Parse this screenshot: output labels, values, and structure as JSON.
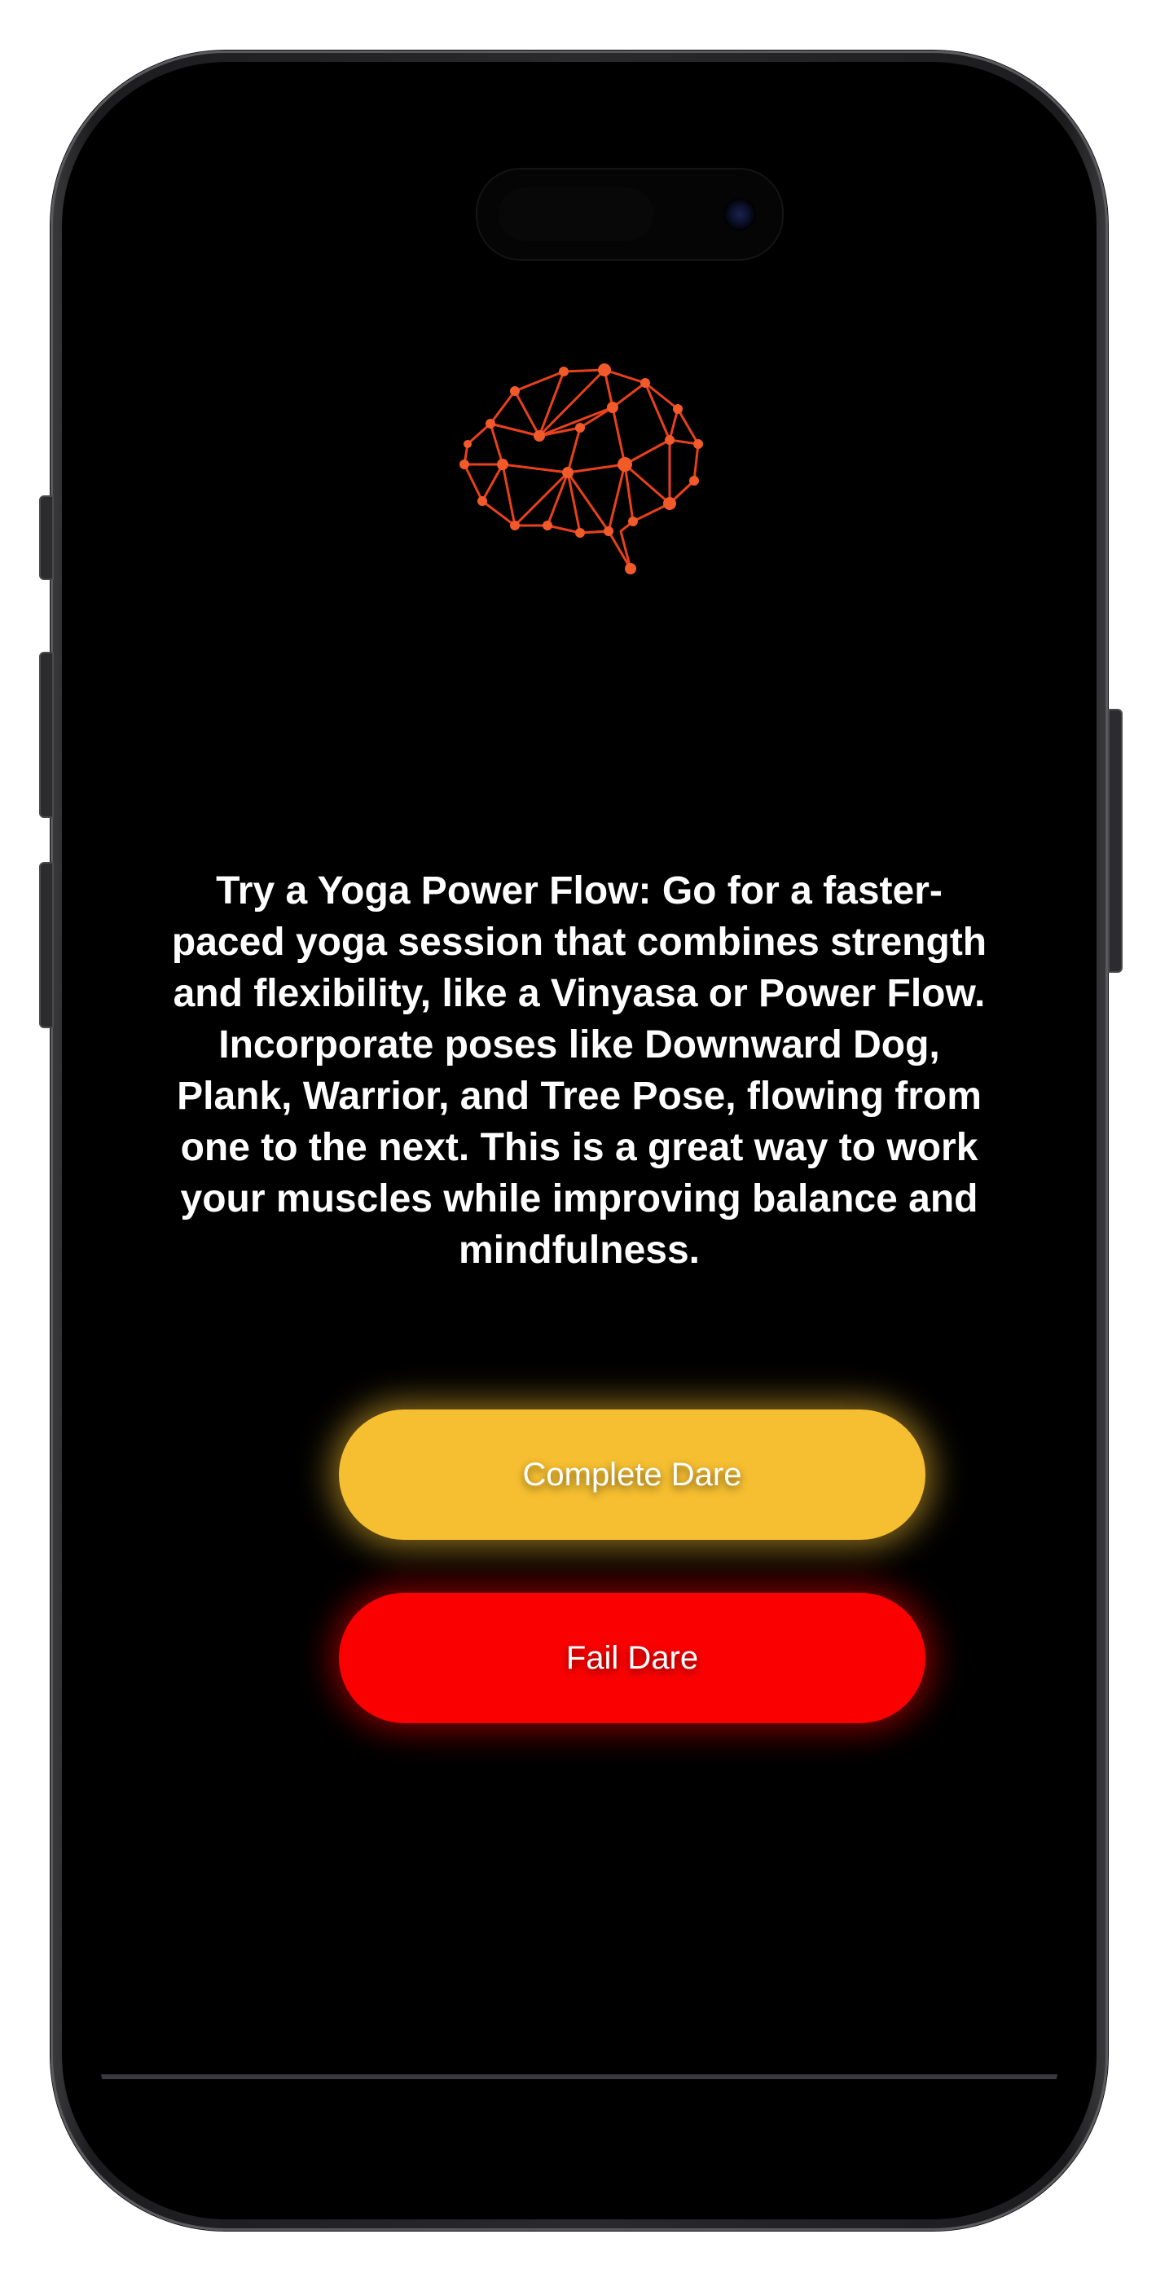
{
  "dare": {
    "text": "Try a Yoga Power Flow: Go for a faster-paced yoga session that combines strength and flexibility, like a Vinyasa or Power Flow. Incorporate poses like Downward Dog, Plank, Warrior, and Tree Pose, flowing from one to the next. This is a great way to work your muscles while improving balance and mindfulness."
  },
  "actions": {
    "complete_label": "Complete Dare",
    "fail_label": "Fail Dare"
  },
  "icons": {
    "logo": "brain-network-icon"
  },
  "colors": {
    "background": "#000000",
    "complete": "#f6bf31",
    "fail": "#fb0000",
    "logo": "#e8401c",
    "text": "#ffffff"
  }
}
